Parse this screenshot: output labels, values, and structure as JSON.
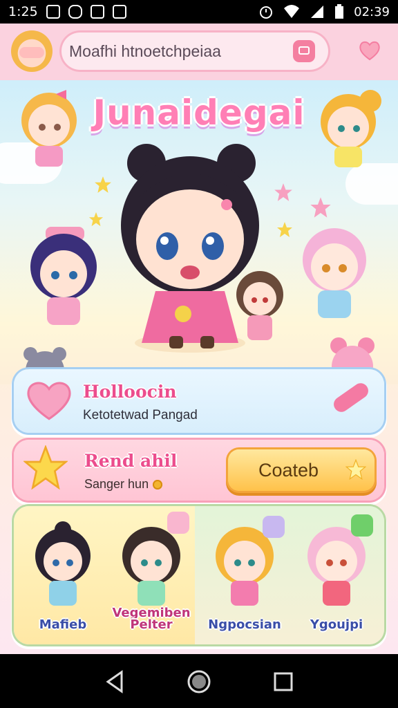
{
  "status_bar": {
    "time": "1:25",
    "clock": "02:39"
  },
  "header": {
    "search_text": "Moafhi htnoetchpeiaa"
  },
  "hero": {
    "title": "Junaidegai"
  },
  "card_1": {
    "title": "Holloocin",
    "subtitle": "Ketotetwad Pangad"
  },
  "card_2": {
    "title": "Rend ahil",
    "subtitle": "Sanger hun",
    "button_label": "Coateb"
  },
  "characters": [
    {
      "name": "Mafieb"
    },
    {
      "name": "Vegemiben Pelter"
    },
    {
      "name": "Ngpocsian"
    },
    {
      "name": "Ygoujpi"
    }
  ],
  "colors": {
    "accent_pink": "#ec4d8d",
    "cta_yellow": "#ffc24a",
    "name_blue": "#3a4ea8"
  }
}
